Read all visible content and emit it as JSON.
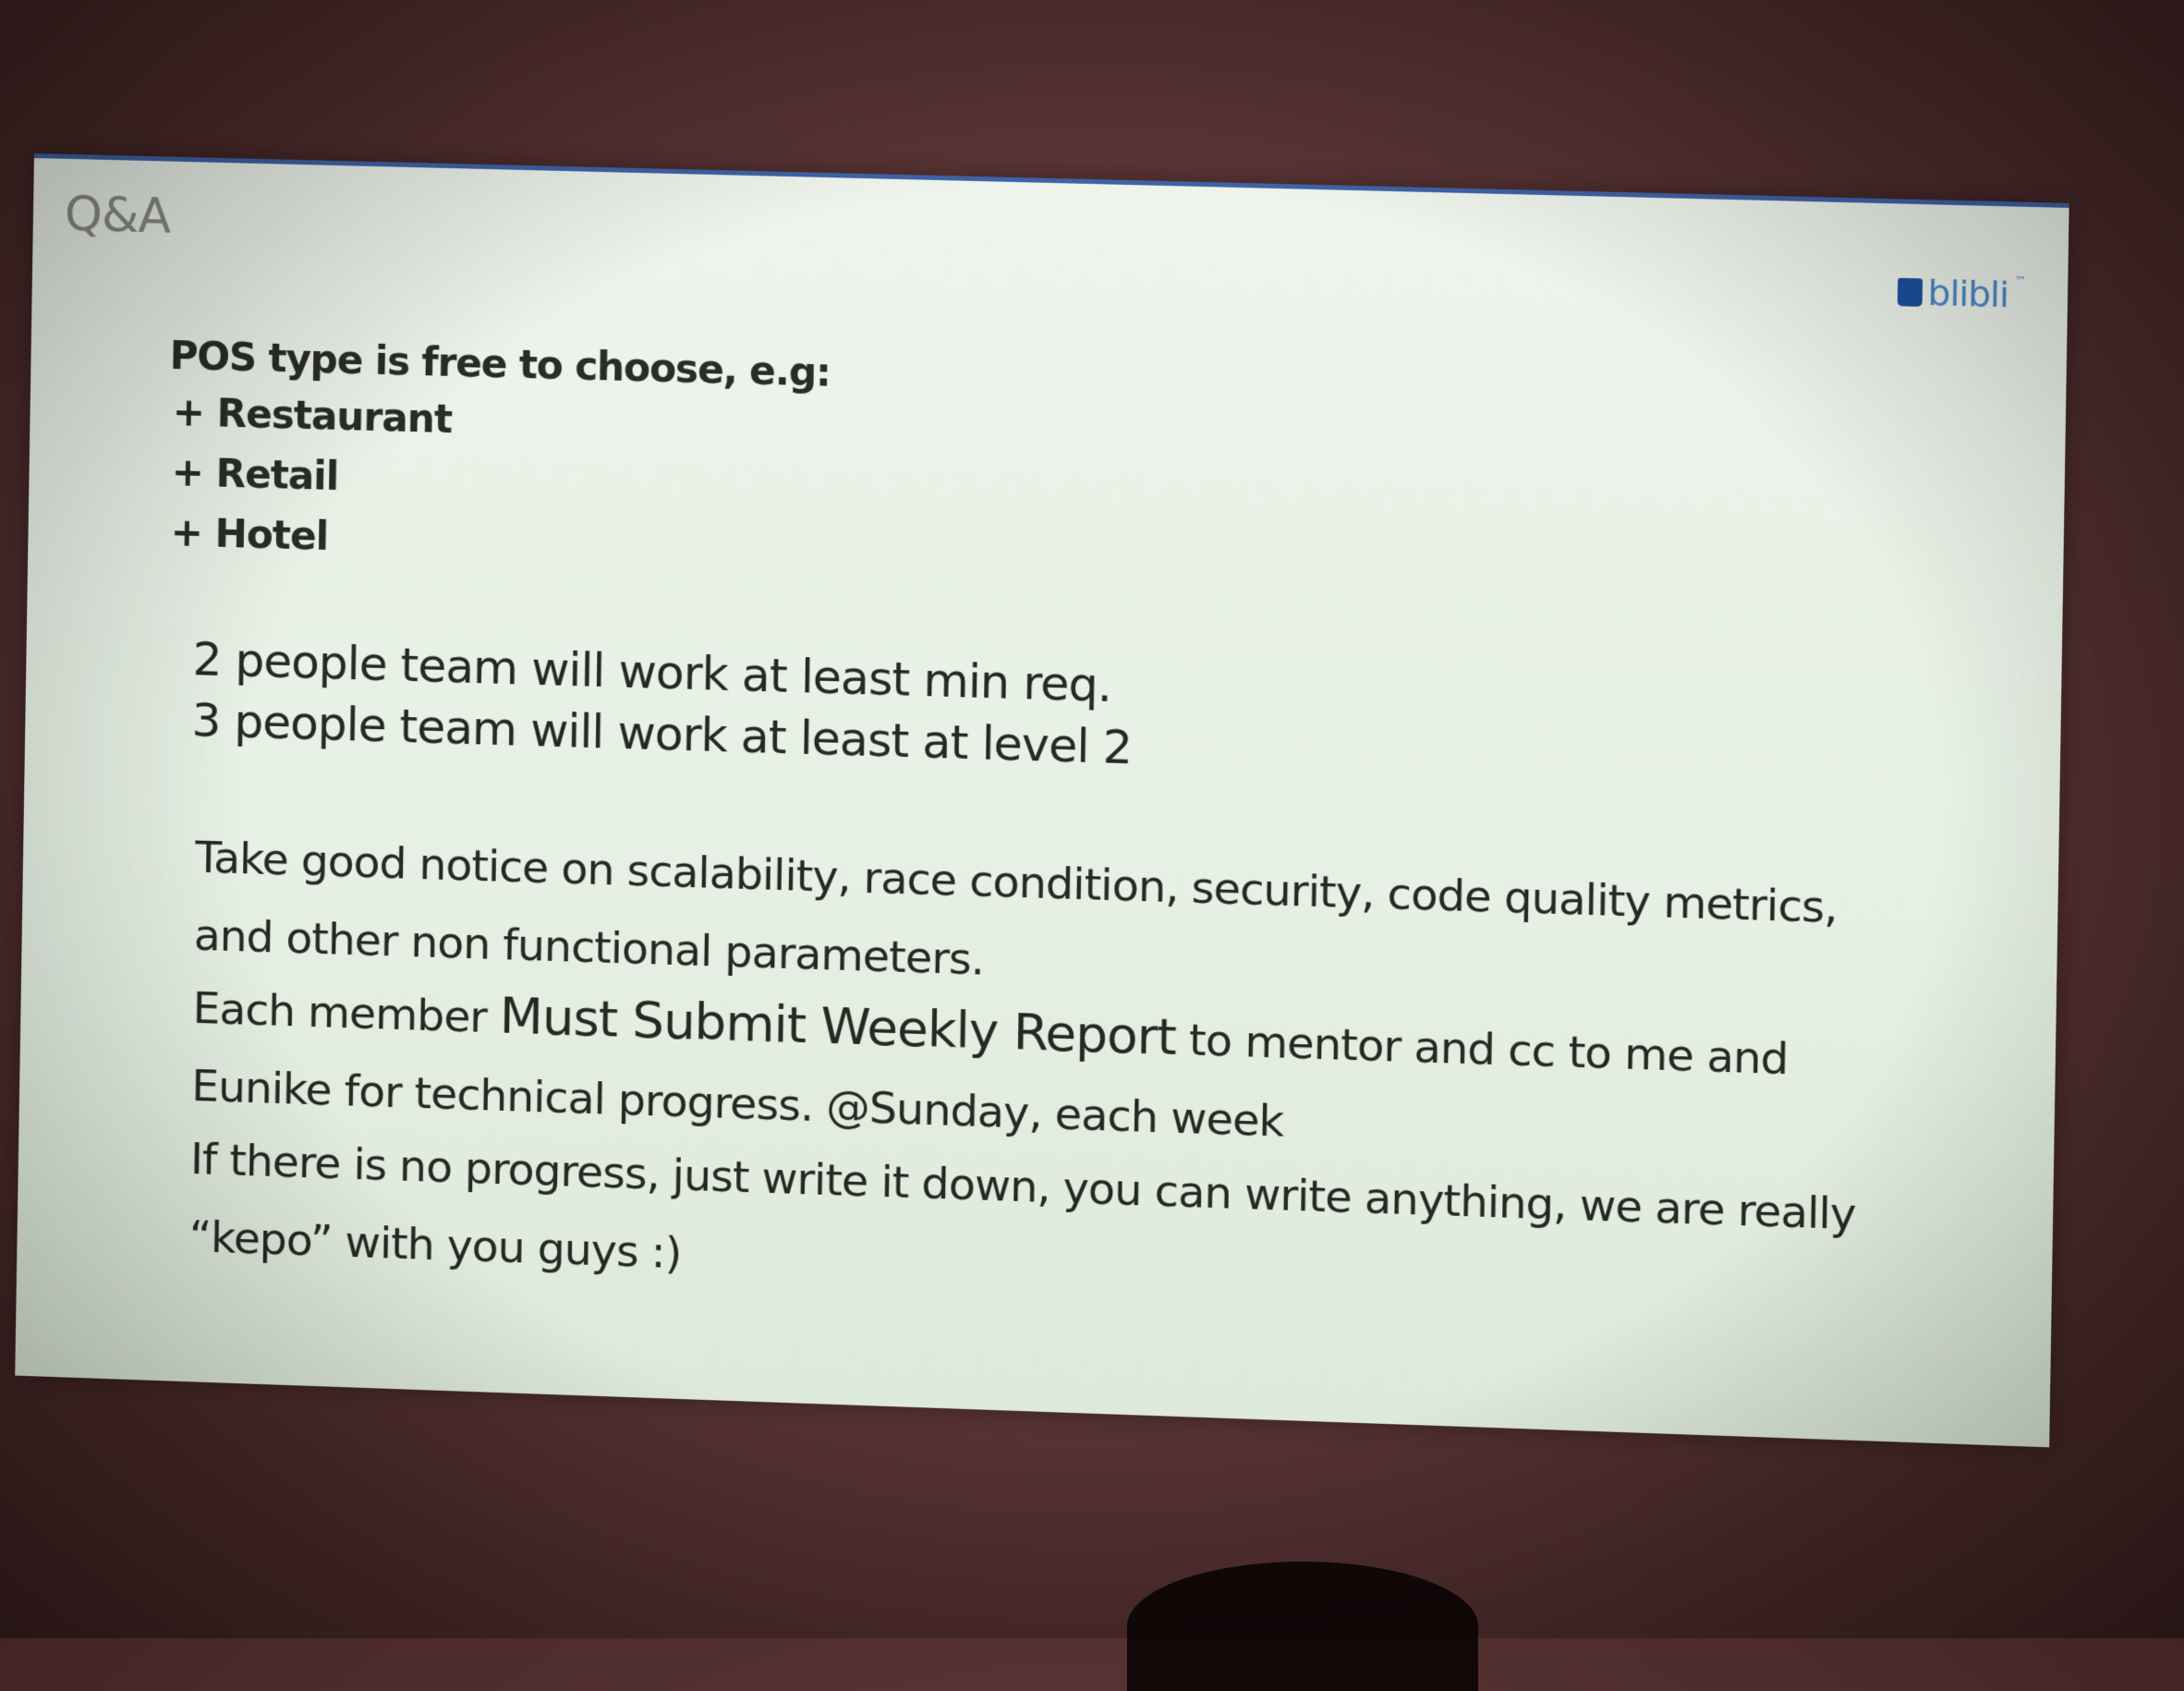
{
  "slide": {
    "title": "Q&A",
    "logo_text": "blibli",
    "logo_mark": "™",
    "intro": "POS type is free to choose, e.g:",
    "options": [
      "+ Restaurant",
      "+ Retail",
      "+ Hotel"
    ],
    "team_lines": [
      "2 people team will work at least min req.",
      "3 people team will work at least at level 2"
    ],
    "notice": "Take good notice on scalability, race condition, security, code quality metrics, and other non functional parameters.",
    "report": {
      "prefix": "Each member ",
      "emphasis": "Must Submit Weekly Report",
      "suffix": " to mentor and cc to me and Eunike for technical progress. @Sunday, each week",
      "followup": "If there is no progress, just write it down, you can write anything, we are really “kepo” with you guys :)"
    }
  },
  "colors": {
    "slide_bg": "#e6f0e4",
    "title_text": "#8a8a87",
    "body_text": "#2a2c28",
    "top_border": "#3f63a6",
    "logo_blue": "#4a86c8",
    "room_wall": "#5b3535"
  }
}
